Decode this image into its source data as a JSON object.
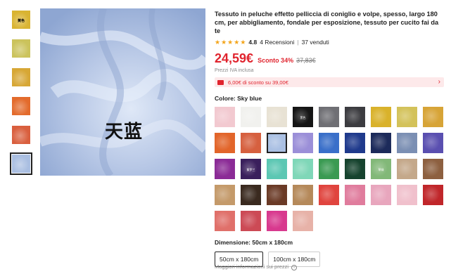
{
  "thumbnails": [
    {
      "color": "#d9b432",
      "label": "黄色"
    },
    {
      "color": "#cbc35c",
      "label": ""
    },
    {
      "color": "#d7a735",
      "label": ""
    },
    {
      "color": "#e36b2c",
      "label": ""
    },
    {
      "color": "#d95f3e",
      "label": ""
    },
    {
      "color": "#a9bee1",
      "label": ""
    }
  ],
  "selected_thumbnail": 5,
  "main_image": {
    "caption": "天蓝",
    "bg": "#b9c8e6"
  },
  "product": {
    "title": "Tessuto in peluche effetto pelliccia di coniglio e volpe, spesso, largo 180 cm, per abbigliamento, fondale per esposizione, tessuto per cucito fai da te",
    "rating": "4.8",
    "reviews": "4 Recensioni",
    "sold": "37 venduti",
    "price": "24,59€",
    "discount": "Sconto 34%",
    "original_price": "37,83€",
    "vat_note": "Prezzi IVA inclusa",
    "coupon": "6,00€ di sconto su 39,00€",
    "color_label": "Colore: Sky blue",
    "dimension_label": "Dimensione: 50cm x 180cm",
    "more_info": "Maggiori informazioni sui prezzi"
  },
  "colors": [
    {
      "c": "#f2c9d0",
      "t": ""
    },
    {
      "c": "#f1f1ee",
      "t": ""
    },
    {
      "c": "#e8e2d4",
      "t": ""
    },
    {
      "c": "#151515",
      "t": "黑色"
    },
    {
      "c": "#6f6f74",
      "t": ""
    },
    {
      "c": "#3c3c40",
      "t": ""
    },
    {
      "c": "#d9b22b",
      "t": ""
    },
    {
      "c": "#d3c25a",
      "t": ""
    },
    {
      "c": "#d7a437",
      "t": ""
    },
    {
      "c": "#e2652a",
      "t": ""
    },
    {
      "c": "#d6603f",
      "t": ""
    },
    {
      "c": "#aac0e3",
      "t": ""
    },
    {
      "c": "#9b8fd8",
      "t": ""
    },
    {
      "c": "#3a6fc9",
      "t": ""
    },
    {
      "c": "#1f3a8c",
      "t": ""
    },
    {
      "c": "#1c2a5a",
      "t": ""
    },
    {
      "c": "#7b8fb3",
      "t": ""
    },
    {
      "c": "#5a4fb0",
      "t": ""
    },
    {
      "c": "#8b2b96",
      "t": ""
    },
    {
      "c": "#3a1f5c",
      "t": "紫罗兰"
    },
    {
      "c": "#5cc7b3",
      "t": ""
    },
    {
      "c": "#7fd7b8",
      "t": ""
    },
    {
      "c": "#3a9a52",
      "t": ""
    },
    {
      "c": "#16432e",
      "t": ""
    },
    {
      "c": "#82b878",
      "t": "草绿"
    },
    {
      "c": "#c4a88a",
      "t": ""
    },
    {
      "c": "#8d6040",
      "t": ""
    },
    {
      "c": "#c49a6a",
      "t": ""
    },
    {
      "c": "#3a2a1f",
      "t": ""
    },
    {
      "c": "#6a3a26",
      "t": ""
    },
    {
      "c": "#b5895a",
      "t": ""
    },
    {
      "c": "#e0443e",
      "t": ""
    },
    {
      "c": "#e07c9d",
      "t": ""
    },
    {
      "c": "#e8a6bd",
      "t": ""
    },
    {
      "c": "#f0c0cc",
      "t": ""
    },
    {
      "c": "#c0262a",
      "t": ""
    },
    {
      "c": "#e0706a",
      "t": ""
    },
    {
      "c": "#cc4a55",
      "t": ""
    },
    {
      "c": "#d8398e",
      "t": ""
    },
    {
      "c": "#e7b2a8",
      "t": ""
    }
  ],
  "selected_color": 11,
  "dimensions": [
    "50cm x 180cm",
    "100cm x 180cm"
  ],
  "selected_dimension": 0
}
